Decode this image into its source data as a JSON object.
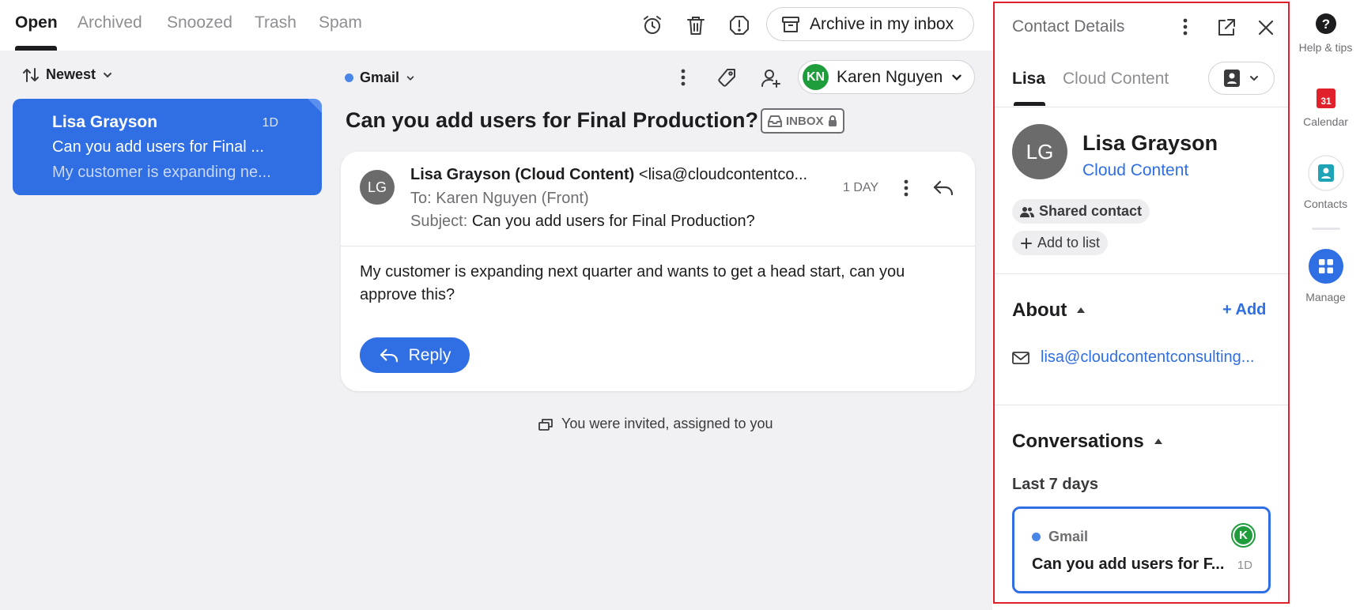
{
  "tabs": {
    "open": "Open",
    "archived": "Archived",
    "snoozed": "Snoozed",
    "trash": "Trash",
    "spam": "Spam"
  },
  "toolbar": {
    "archive_label": "Archive in my inbox"
  },
  "list": {
    "sort_label": "Newest",
    "conversation": {
      "sender": "Lisa Grayson",
      "time": "1D",
      "subject": "Can you add users for Final ...",
      "preview": "My customer is expanding ne..."
    }
  },
  "conversation": {
    "channel": "Gmail",
    "assignee_initials": "KN",
    "assignee_name": "Karen Nguyen",
    "title": "Can you add users for Final Production?",
    "inbox_badge": "INBOX",
    "message": {
      "avatar_initials": "LG",
      "from_name": "Lisa Grayson (Cloud Content)",
      "from_email": "<lisa@cloudcontentco...",
      "time": "1 DAY",
      "to_label": "To:",
      "to_value": "Karen Nguyen (Front)",
      "subject_label": "Subject:",
      "subject_value": "Can you add users for Final Production?",
      "body": "My customer is expanding next quarter and wants to get a head start, can you approve this?",
      "reply_label": "Reply"
    },
    "event_text": "You were invited, assigned to you"
  },
  "contact_panel": {
    "title": "Contact Details",
    "tabs": {
      "person": "Lisa",
      "company": "Cloud Content"
    },
    "avatar_initials": "LG",
    "name": "Lisa Grayson",
    "company": "Cloud Content",
    "shared_label": "Shared contact",
    "add_list_label": "Add to list",
    "about_label": "About",
    "add_label": "+ Add",
    "email": "lisa@cloudcontentconsulting...",
    "conversations_label": "Conversations",
    "last7_label": "Last 7 days",
    "conv_card": {
      "channel": "Gmail",
      "assignee_initial": "K",
      "subject": "Can you add users for F...",
      "time": "1D"
    }
  },
  "rail": {
    "help": "Help & tips",
    "calendar": "Calendar",
    "calendar_day": "31",
    "contacts": "Contacts",
    "manage": "Manage"
  },
  "colors": {
    "accent": "#2f6ee3",
    "green": "#1f9d3c",
    "highlight_border": "#e0202a"
  }
}
